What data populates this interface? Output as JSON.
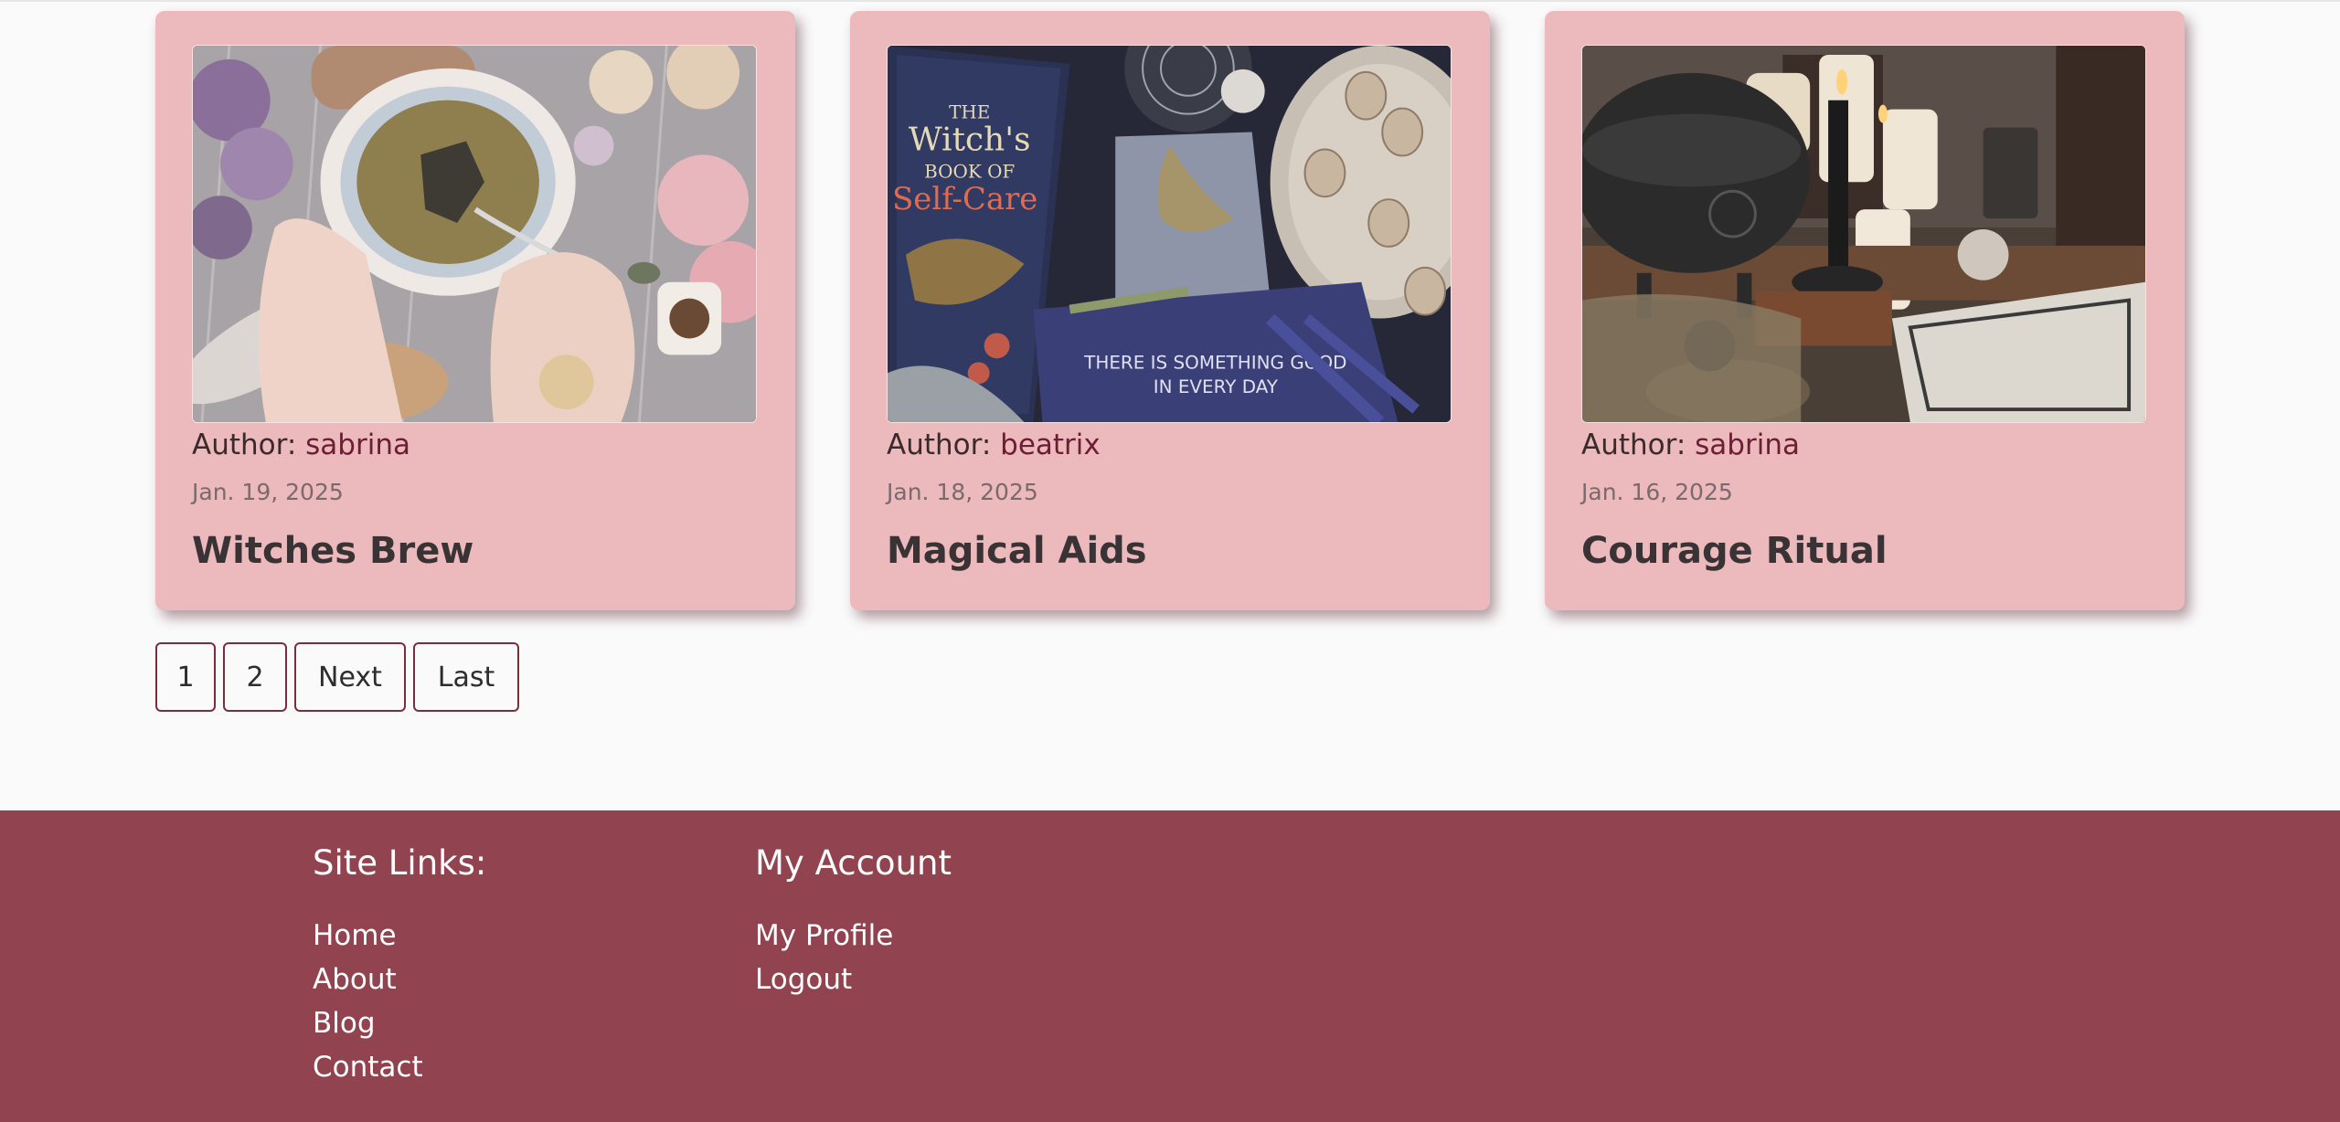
{
  "cards": [
    {
      "image_alt": "Hands holding a cup of herbal tea among dried flowers",
      "author_label": "Author:",
      "author": "sabrina",
      "date": "Jan. 19, 2025",
      "title": "Witches Brew"
    },
    {
      "image_alt": "The Witch's Book of Self-Care with herbs, crystals and candles",
      "author_label": "Author:",
      "author": "beatrix",
      "date": "Jan. 18, 2025",
      "title": "Magical Aids",
      "book_title_1": "THE",
      "book_title_2": "Witch's",
      "book_title_3": "BOOK OF",
      "book_title_4": "Self-Care",
      "notebook_text_1": "THERE IS SOMETHING GOOD",
      "notebook_text_2": "IN EVERY DAY"
    },
    {
      "image_alt": "Cast iron cauldron with black candle and lit candles",
      "author_label": "Author:",
      "author": "sabrina",
      "date": "Jan. 16, 2025",
      "title": "Courage Ritual"
    }
  ],
  "pagination": [
    "1",
    "2",
    "Next",
    "Last"
  ],
  "footer": {
    "site_links_heading": "Site Links:",
    "site_links": [
      "Home",
      "About",
      "Blog",
      "Contact"
    ],
    "account_heading": "My Account",
    "account_links": [
      "My Profile",
      "Logout"
    ]
  },
  "colors": {
    "card_bg": "#ecb9bc",
    "footer_bg": "#924350",
    "accent": "#6b1f34"
  }
}
